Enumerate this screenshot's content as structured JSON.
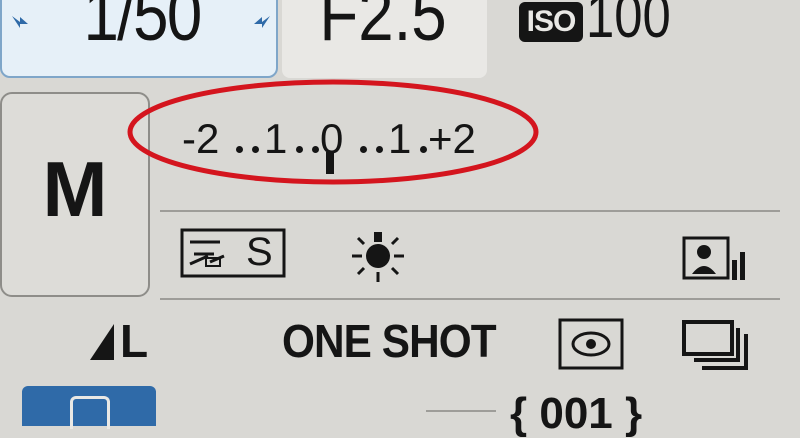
{
  "top": {
    "shutter_speed": "1/50",
    "aperture": "F2.5",
    "iso_label": "ISO",
    "iso_value": "100"
  },
  "mode": {
    "label": "M"
  },
  "exposure_scale": {
    "labels": [
      "-2",
      "1",
      "0",
      "1",
      "+2"
    ]
  },
  "mid_row": {
    "white_balance_icon": "white-balance-shade-icon",
    "metering_icon": "sun-icon",
    "picture_style_icon": "picture-style-portrait-icon",
    "wb_suffix": "S"
  },
  "bottom_row": {
    "quality_label": "L",
    "af_mode": "ONE SHOT",
    "metering_icon": "metering-evaluative-icon",
    "drive_icon": "continuous-drive-icon"
  },
  "bottom_strip": {
    "shots_remaining": "{ 001 }"
  },
  "colors": {
    "background": "#d9d8d4",
    "highlight_blue": "#7fa6c9",
    "annotation_red": "#d4151e"
  }
}
